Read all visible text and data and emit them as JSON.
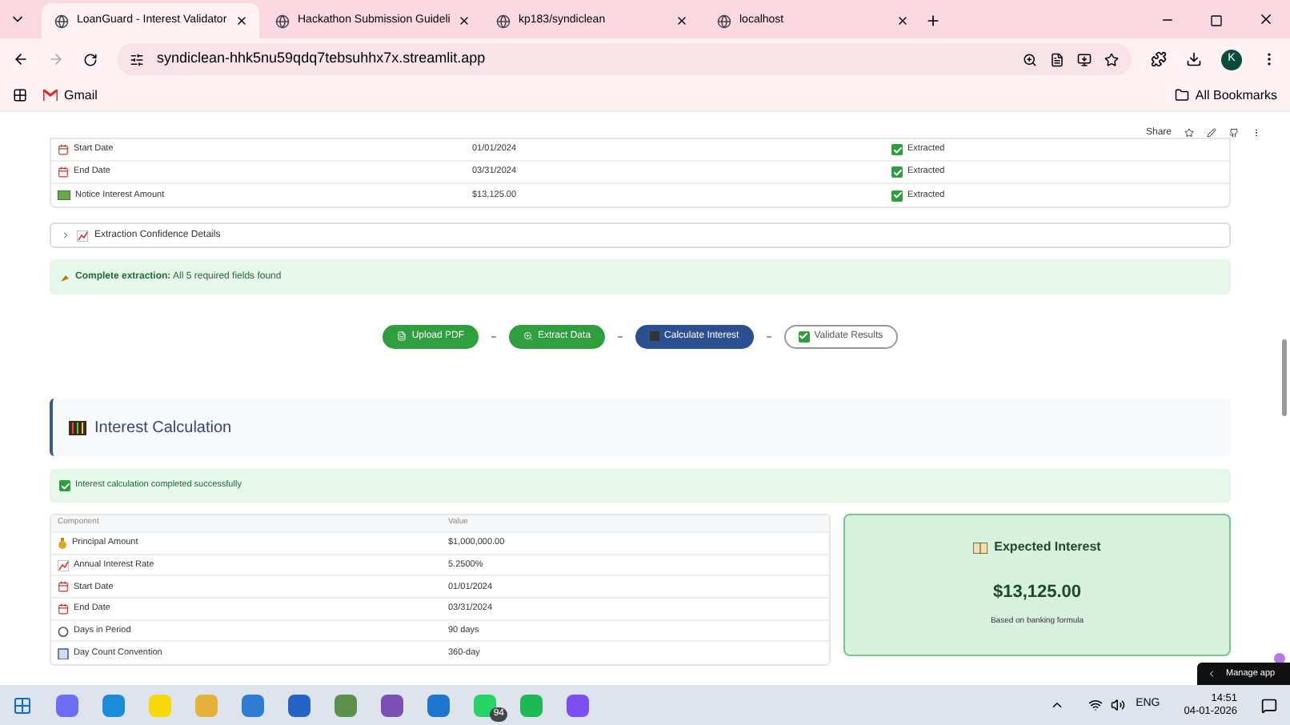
{
  "browser": {
    "tabs": [
      {
        "title": "LoanGuard - Interest Validator",
        "selected": true
      },
      {
        "title": "Hackathon Submission Guideli",
        "selected": false
      },
      {
        "title": "kp183/syndiclean",
        "selected": false
      },
      {
        "title": "localhost",
        "selected": false
      }
    ],
    "url": "syndiclean-hhk5nu59qdq7tebsuhhx7x.streamlit.app",
    "avatar": "K",
    "bookmarks": [
      "Gmail"
    ],
    "all_bookmarks": "All Bookmarks"
  },
  "app_toolbar": {
    "share": "Share"
  },
  "extraction_rows": [
    {
      "field": "Start Date",
      "value": "01/01/2024",
      "status": "Extracted"
    },
    {
      "field": "End Date",
      "value": "03/31/2024",
      "status": "Extracted"
    },
    {
      "field": "Notice Interest Amount",
      "value": "$13,125.00",
      "status": "Extracted"
    }
  ],
  "expander": {
    "label": "Extraction Confidence Details",
    "expanded": false
  },
  "extraction_notice": "**Complete extraction:** All 5 required fields found",
  "steps": [
    {
      "label": "Upload PDF",
      "kind": "done"
    },
    {
      "label": "Extract Data",
      "kind": "done"
    },
    {
      "label": "Calculate Interest",
      "kind": "active"
    },
    {
      "label": "Validate Results",
      "kind": "pending"
    }
  ],
  "section_title": "Interest Calculation",
  "calc_notice": "Interest calculation completed successfully",
  "calc_table": {
    "columns": [
      "Component",
      "Value"
    ],
    "rows": [
      [
        "Principal Amount",
        "$1,000,000.00"
      ],
      [
        "Annual Interest Rate",
        "5.2500%"
      ],
      [
        "Start Date",
        "01/01/2024"
      ],
      [
        "End Date",
        "03/31/2024"
      ],
      [
        "Days in Period",
        "90 days"
      ],
      [
        "Day Count Convention",
        "360-day"
      ]
    ]
  },
  "expected": {
    "title": "Expected Interest",
    "amount": "$13,125.00",
    "note": "Based on banking formula"
  },
  "manage_app": "Manage app",
  "taskbar": {
    "badge": "94",
    "language": "ENG",
    "time": "14:51",
    "date": "04-01-2026"
  }
}
